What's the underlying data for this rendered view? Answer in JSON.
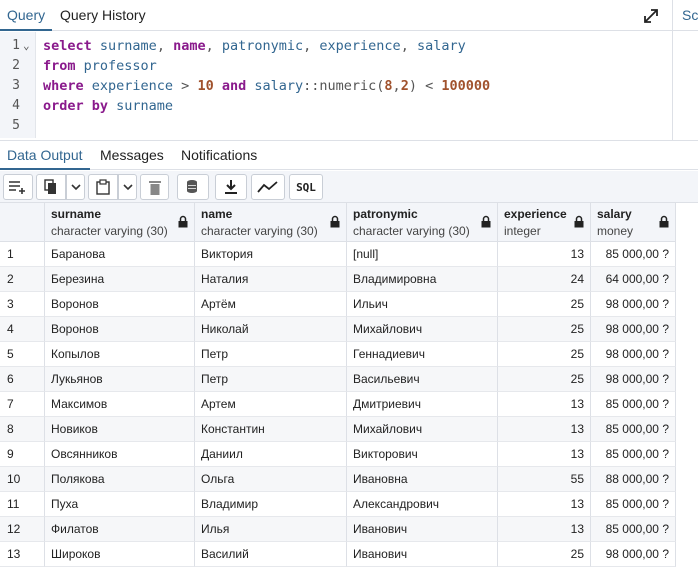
{
  "top_tabs": [
    {
      "label": "Query"
    },
    {
      "label": "Query History"
    }
  ],
  "side_tab_label": "Sc",
  "editor": {
    "line_numbers": [
      "1",
      "2",
      "3",
      "4",
      "5"
    ]
  },
  "sql": {
    "l1_kw": "select",
    "l1_cols": [
      " surname",
      ",",
      " name",
      ",",
      " patronymic",
      ",",
      " experience",
      ",",
      " salary"
    ],
    "l2_kw": "from",
    "l2_table": " professor",
    "l3_kw1": "where",
    "l3_col1": " experience",
    "l3_gt": " >",
    "l3_num1": " 10",
    "l3_and": " and",
    "l3_col2": " salary",
    "l3_cast": "::numeric(",
    "l3_p1": "8",
    "l3_comma": ",",
    "l3_p2": "2",
    "l3_close": ")",
    "l3_lt": " <",
    "l3_num2": " 100000",
    "l4_kw": "order by",
    "l4_col": " surname"
  },
  "output_tabs": [
    {
      "label": "Data Output"
    },
    {
      "label": "Messages"
    },
    {
      "label": "Notifications"
    }
  ],
  "toolbar": {
    "sql_label": "SQL"
  },
  "table": {
    "columns": [
      {
        "name": "surname",
        "type": "character varying (30)"
      },
      {
        "name": "name",
        "type": "character varying (30)"
      },
      {
        "name": "patronymic",
        "type": "character varying (30)"
      },
      {
        "name": "experience",
        "type": "integer"
      },
      {
        "name": "salary",
        "type": "money"
      }
    ],
    "rows": [
      {
        "n": "1",
        "surname": "Баранова",
        "name": "Виктория",
        "patronymic": "[null]",
        "experience": "13",
        "salary": "85 000,00 ?"
      },
      {
        "n": "2",
        "surname": "Березина",
        "name": "Наталия",
        "patronymic": "Владимировна",
        "experience": "24",
        "salary": "64 000,00 ?"
      },
      {
        "n": "3",
        "surname": "Воронов",
        "name": "Артём",
        "patronymic": "Ильич",
        "experience": "25",
        "salary": "98 000,00 ?"
      },
      {
        "n": "4",
        "surname": "Воронов",
        "name": "Николай",
        "patronymic": "Михайлович",
        "experience": "25",
        "salary": "98 000,00 ?"
      },
      {
        "n": "5",
        "surname": "Копылов",
        "name": "Петр",
        "patronymic": "Геннадиевич",
        "experience": "25",
        "salary": "98 000,00 ?"
      },
      {
        "n": "6",
        "surname": "Лукьянов",
        "name": "Петр",
        "patronymic": "Васильевич",
        "experience": "25",
        "salary": "98 000,00 ?"
      },
      {
        "n": "7",
        "surname": "Максимов",
        "name": "Артем",
        "patronymic": "Дмитриевич",
        "experience": "13",
        "salary": "85 000,00 ?"
      },
      {
        "n": "8",
        "surname": "Новиков",
        "name": "Константин",
        "patronymic": "Михайлович",
        "experience": "13",
        "salary": "85 000,00 ?"
      },
      {
        "n": "9",
        "surname": "Овсянников",
        "name": "Даниил",
        "patronymic": "Викторович",
        "experience": "13",
        "salary": "85 000,00 ?"
      },
      {
        "n": "10",
        "surname": "Полякова",
        "name": "Ольга",
        "patronymic": "Ивановна",
        "experience": "55",
        "salary": "88 000,00 ?"
      },
      {
        "n": "11",
        "surname": "Пуха",
        "name": "Владимир",
        "patronymic": "Александрович",
        "experience": "13",
        "salary": "85 000,00 ?"
      },
      {
        "n": "12",
        "surname": "Филатов",
        "name": "Илья",
        "patronymic": "Иванович",
        "experience": "13",
        "salary": "85 000,00 ?"
      },
      {
        "n": "13",
        "surname": "Широков",
        "name": "Василий",
        "patronymic": "Иванович",
        "experience": "25",
        "salary": "98 000,00 ?"
      }
    ]
  },
  "colors": {
    "accent": "#326690",
    "keyword": "#8a1a8c",
    "number": "#a0522d"
  }
}
